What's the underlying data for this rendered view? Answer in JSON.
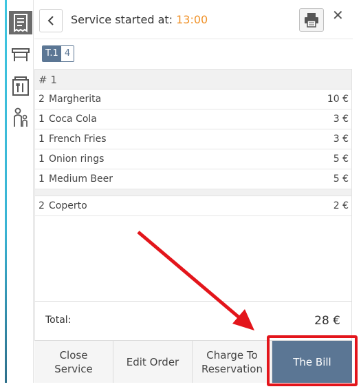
{
  "header": {
    "title_prefix": "Service started at: ",
    "start_time": "13:00",
    "close_symbol": "✕"
  },
  "table_tag": {
    "label": "T.1",
    "count": "4"
  },
  "order": {
    "groups": [
      {
        "title": "# 1",
        "items": [
          {
            "qty": "2",
            "name": "Margherita",
            "price": "10 €"
          },
          {
            "qty": "1",
            "name": "Coca Cola",
            "price": "3 €"
          },
          {
            "qty": "1",
            "name": "French Fries",
            "price": "3 €"
          },
          {
            "qty": "1",
            "name": "Onion rings",
            "price": "5 €"
          },
          {
            "qty": "1",
            "name": "Medium Beer",
            "price": "5 €"
          }
        ]
      }
    ],
    "extras": [
      {
        "qty": "2",
        "name": "Coperto",
        "price": "2 €"
      }
    ]
  },
  "total": {
    "label": "Total:",
    "value": "28 €"
  },
  "footer": {
    "close_service_line1": "Close",
    "close_service_line2": "Service",
    "edit_order": "Edit Order",
    "charge_line1": "Charge To",
    "charge_line2": "Reservation",
    "the_bill": "The Bill"
  },
  "rail": {
    "icons": [
      "receipt-icon",
      "table-icon",
      "kitchen-icon",
      "customer-icon"
    ]
  },
  "colors": {
    "accent": "#f0932b",
    "primary": "#5b7694",
    "annotation": "#e3151b"
  }
}
